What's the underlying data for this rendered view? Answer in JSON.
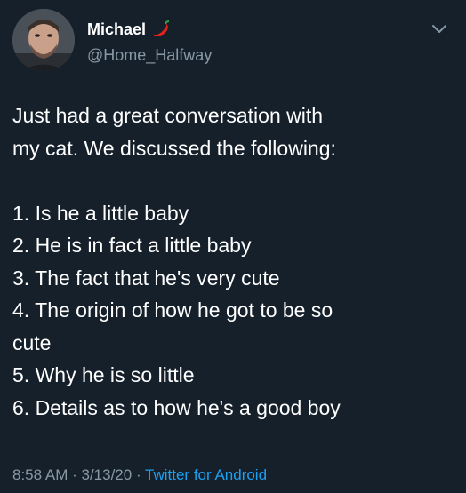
{
  "author": {
    "display_name": "Michael",
    "handle": "@Home_Halfway",
    "name_emoji": "chili-pepper-icon",
    "avatar": "profile-photo"
  },
  "tweet": {
    "lines": [
      "Just had a great conversation with",
      "my cat. We discussed the following:",
      "",
      "1. Is he a little baby",
      "2. He is in fact a little baby",
      "3. The fact that he's very cute",
      "4. The origin of how he got to be so",
      "cute",
      "5. Why he is so little",
      "6. Details as to how he's a good boy"
    ]
  },
  "meta": {
    "time": "8:58 AM",
    "separator": " · ",
    "date": "3/13/20",
    "source": "Twitter for Android"
  },
  "colors": {
    "background": "#15202b",
    "text": "#ffffff",
    "secondary": "#8899a6",
    "link": "#1da1f2"
  },
  "icons": {
    "menu": "chevron-down-icon"
  }
}
